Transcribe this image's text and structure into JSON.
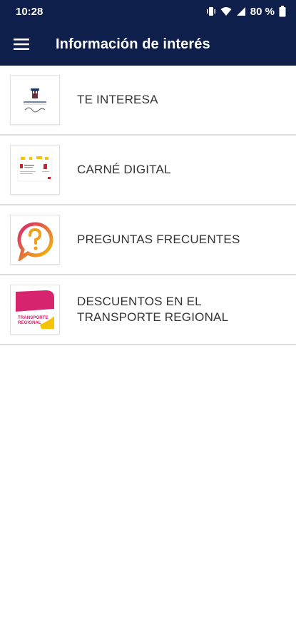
{
  "status_bar": {
    "time": "10:28",
    "battery": "80 %",
    "icons": [
      "vibrate-icon",
      "wifi-icon",
      "signal-icon",
      "battery-icon"
    ]
  },
  "app_bar": {
    "title": "Información de interés",
    "menu_icon": "hamburger-menu-icon"
  },
  "list": {
    "items": [
      {
        "label": "TE INTERESA",
        "icon": "junta-logo-thumbnail"
      },
      {
        "label": "CARNÉ DIGITAL",
        "icon": "digital-card-thumbnail"
      },
      {
        "label": "PREGUNTAS FRECUENTES",
        "icon": "question-bubble-thumbnail"
      },
      {
        "label": "DESCUENTOS EN EL TRANSPORTE REGIONAL",
        "icon": "transport-thumbnail",
        "thumb_text": "TRANSPORTE REGIONAL"
      }
    ]
  },
  "colors": {
    "header_bg": "#0f1f4b",
    "divider": "#dcdcdc",
    "magenta": "#d6246e",
    "yellow": "#f5c400"
  }
}
